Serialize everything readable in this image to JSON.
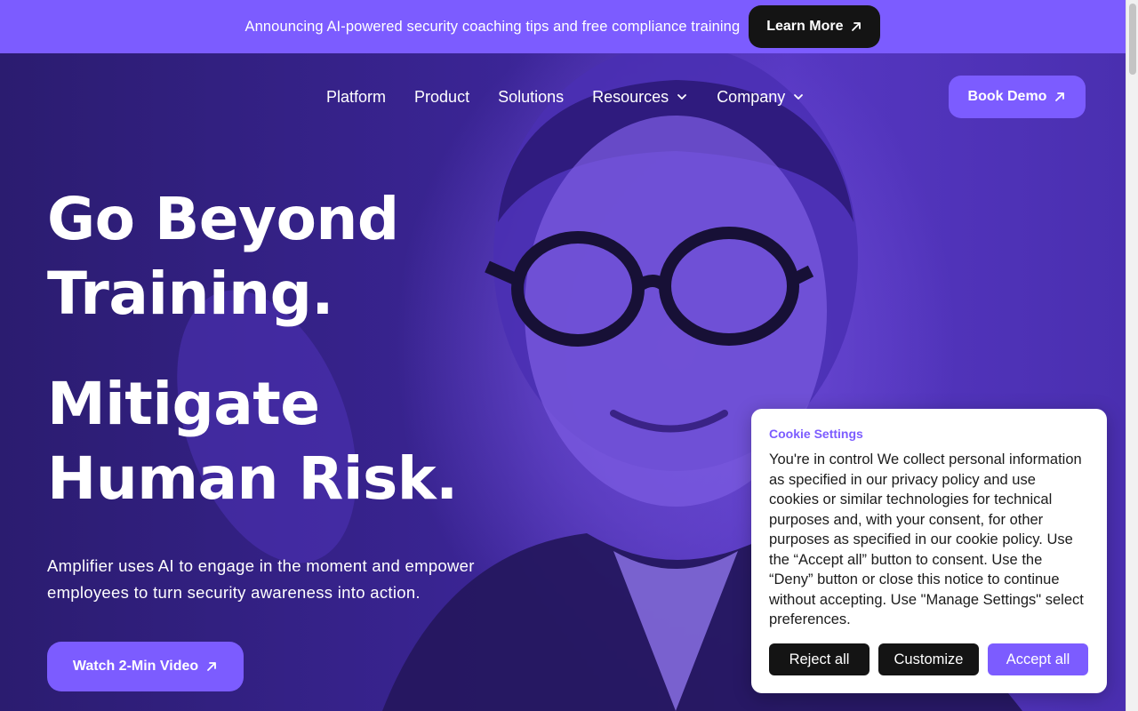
{
  "announcement": {
    "text": "Announcing AI-powered security coaching tips and free compliance training",
    "button_label": "Learn More"
  },
  "nav": {
    "items": [
      {
        "label": "Platform",
        "has_dropdown": false
      },
      {
        "label": "Product",
        "has_dropdown": false
      },
      {
        "label": "Solutions",
        "has_dropdown": false
      },
      {
        "label": "Resources",
        "has_dropdown": true
      },
      {
        "label": "Company",
        "has_dropdown": true
      }
    ],
    "cta_label": "Book Demo"
  },
  "hero": {
    "headline_lines": [
      "Go Beyond",
      "Training.",
      "Mitigate",
      "Human Risk."
    ],
    "subtext": "Amplifier uses AI to engage in the moment and empower employees to turn security awareness into action.",
    "video_button_label": "Watch 2-Min Video"
  },
  "cookie_panel": {
    "title": "Cookie Settings",
    "body": "You're in control We collect personal information as specified in our privacy policy and use cookies or similar technologies for technical purposes and, with your consent, for other purposes as specified in our cookie policy. Use the “Accept all” button to consent. Use the “Deny” button or close this notice to continue without accepting. Use \"Manage Settings\" select preferences.",
    "buttons": {
      "reject": "Reject all",
      "customize": "Customize",
      "accept": "Accept all"
    }
  },
  "colors": {
    "accent": "#7c5cff",
    "dark_button": "#141414",
    "hero_bg": "#3b2596"
  },
  "icons": {
    "external_link": "arrow-up-right-icon",
    "dropdown": "chevron-down-icon"
  }
}
